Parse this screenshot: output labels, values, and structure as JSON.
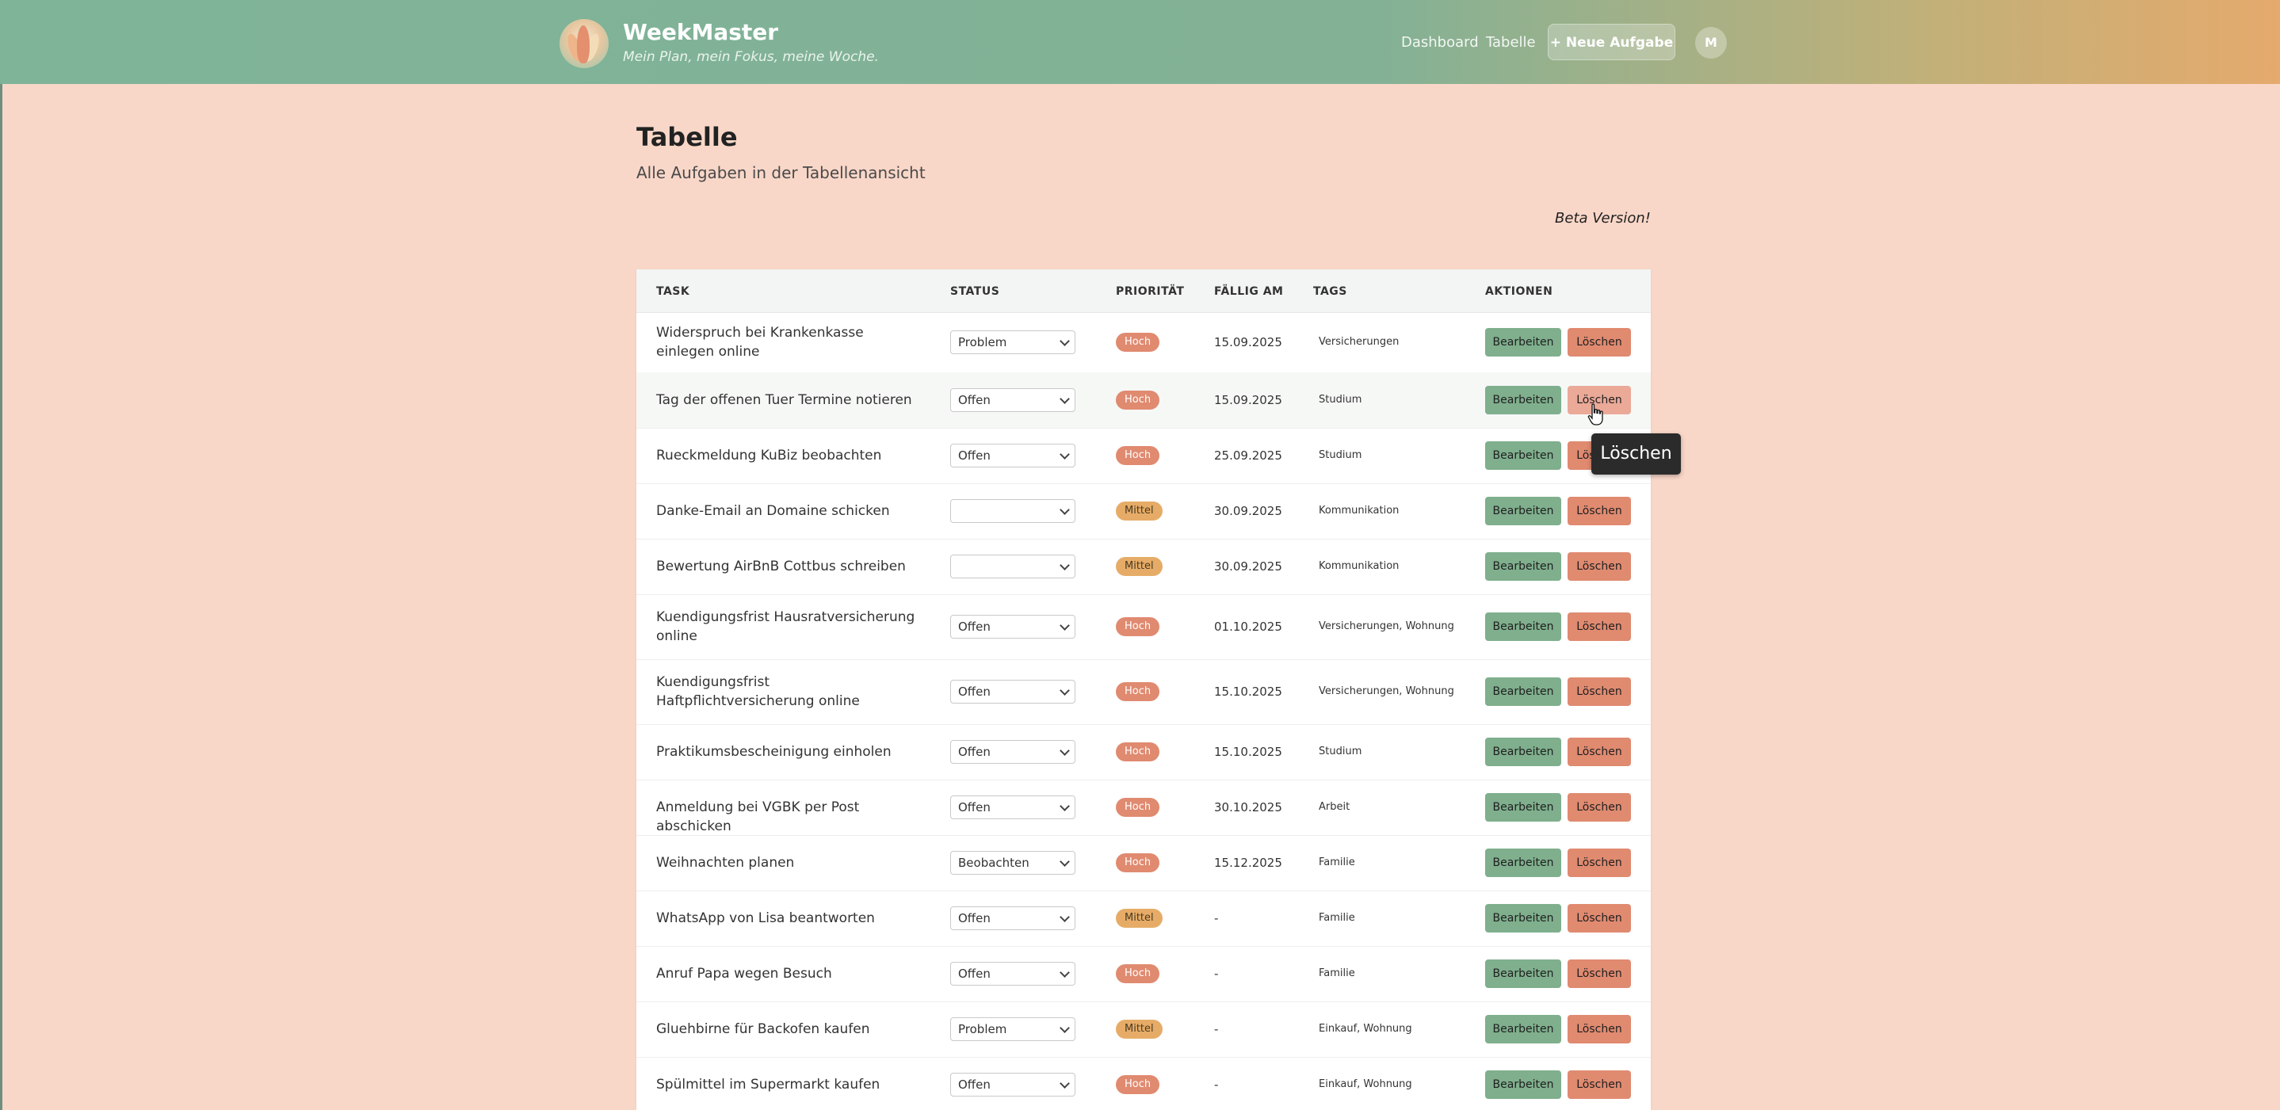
{
  "app": {
    "name": "WeekMaster",
    "tagline": "Mein Plan, mein Fokus, meine Woche."
  },
  "nav": {
    "dashboard": "Dashboard",
    "table": "Tabelle",
    "new_task": "+ Neue Aufgabe",
    "avatar_initial": "M"
  },
  "page": {
    "title": "Tabelle",
    "subtitle": "Alle Aufgaben in der Tabellenansicht",
    "beta": "Beta Version!"
  },
  "table": {
    "headers": {
      "task": "TASK",
      "status": "STATUS",
      "priority": "PRIORITÄT",
      "due": "FÄLLIG AM",
      "tags": "TAGS",
      "actions": "AKTIONEN"
    },
    "edit_label": "Bearbeiten",
    "delete_label": "Löschen",
    "rows": [
      {
        "task": "Widerspruch bei Krankenkasse einlegen online",
        "status": "Problem",
        "priority": "Hoch",
        "due": "15.09.2025",
        "tags": "Versicherungen"
      },
      {
        "task": "Tag der offenen Tuer Termine notieren",
        "status": "Offen",
        "priority": "Hoch",
        "due": "15.09.2025",
        "tags": "Studium"
      },
      {
        "task": "Rueckmeldung KuBiz beobachten",
        "status": "Offen",
        "priority": "Hoch",
        "due": "25.09.2025",
        "tags": "Studium"
      },
      {
        "task": "Danke-Email an Domaine schicken",
        "status": "",
        "priority": "Mittel",
        "due": "30.09.2025",
        "tags": "Kommunikation"
      },
      {
        "task": "Bewertung AirBnB Cottbus schreiben",
        "status": "",
        "priority": "Mittel",
        "due": "30.09.2025",
        "tags": "Kommunikation"
      },
      {
        "task": "Kuendigungsfrist Hausratversicherung online",
        "status": "Offen",
        "priority": "Hoch",
        "due": "01.10.2025",
        "tags": "Versicherungen, Wohnung"
      },
      {
        "task": "Kuendigungsfrist Haftpflichtversicherung online",
        "status": "Offen",
        "priority": "Hoch",
        "due": "15.10.2025",
        "tags": "Versicherungen, Wohnung"
      },
      {
        "task": "Praktikumsbescheinigung einholen",
        "status": "Offen",
        "priority": "Hoch",
        "due": "15.10.2025",
        "tags": "Studium"
      },
      {
        "task": "Anmeldung bei VGBK per Post abschicken",
        "status": "Offen",
        "priority": "Hoch",
        "due": "30.10.2025",
        "tags": "Arbeit"
      },
      {
        "task": "Weihnachten planen",
        "status": "Beobachten",
        "priority": "Hoch",
        "due": "15.12.2025",
        "tags": "Familie"
      },
      {
        "task": "WhatsApp von Lisa beantworten",
        "status": "Offen",
        "priority": "Mittel",
        "due": "-",
        "tags": "Familie"
      },
      {
        "task": "Anruf Papa wegen Besuch",
        "status": "Offen",
        "priority": "Hoch",
        "due": "-",
        "tags": "Familie"
      },
      {
        "task": "Gluehbirne für Backofen kaufen",
        "status": "Problem",
        "priority": "Mittel",
        "due": "-",
        "tags": "Einkauf, Wohnung"
      },
      {
        "task": "Spülmittel im Supermarkt kaufen",
        "status": "Offen",
        "priority": "Hoch",
        "due": "-",
        "tags": "Einkauf, Wohnung"
      }
    ]
  },
  "tooltip": {
    "text": "Löschen"
  },
  "colors": {
    "header_start": "#7fb498",
    "header_end": "#e5aa6d",
    "page_background": "#f9d7c8",
    "edit_button": "#7faf8d",
    "delete_button": "#e08a70",
    "priority_high": "#e08a70",
    "priority_medium": "#e6ac67"
  }
}
